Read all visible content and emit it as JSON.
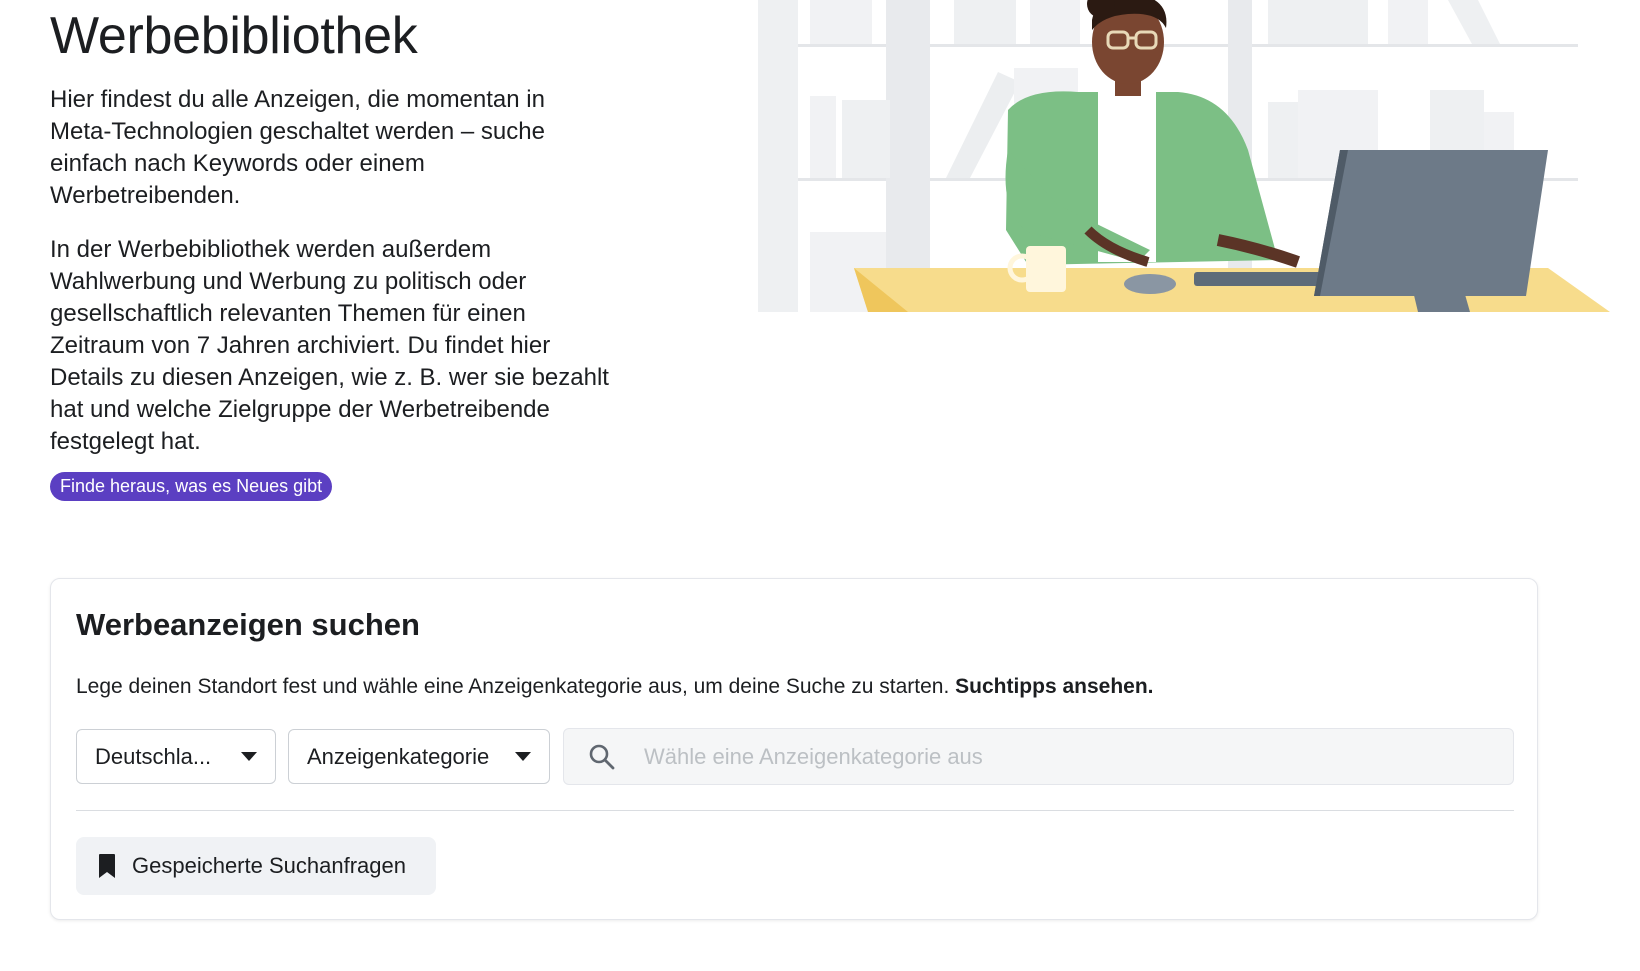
{
  "hero": {
    "title": "Werbebibliothek",
    "paragraph1": "Hier findest du alle Anzeigen, die momentan in Meta-Technologien geschaltet werden – suche einfach nach Keywords oder einem Werbetreibenden.",
    "paragraph2": "In der Werbebibliothek werden außerdem Wahlwerbung und Werbung zu politisch oder gesellschaftlich relevanten Themen für einen Zeitraum von 7 Jahren archiviert. Du findet hier Details zu diesen Anzeigen, wie z. B. wer sie bezahlt hat und welche Zielgruppe der Werbetreibende festgelegt hat.",
    "news_pill": "Finde heraus, was es Neues gibt",
    "illustration_icon": "person-at-computer-illustration"
  },
  "search_card": {
    "title": "Werbeanzeigen suchen",
    "description": "Lege deinen Standort fest und wähle eine Anzeigenkategorie aus, um deine Suche zu starten.",
    "tips_link": "Suchtipps ansehen.",
    "country_select": "Deutschla...",
    "category_select": "Anzeigenkategorie",
    "search_placeholder": "Wähle eine Anzeigenkategorie aus",
    "search_value": "",
    "saved_searches_label": "Gespeicherte Suchanfragen",
    "icons": {
      "search": "search-icon",
      "bookmark": "bookmark-icon",
      "caret": "caret-down-icon"
    }
  },
  "colors": {
    "accent_pill": "#5b3fc2",
    "text": "#1c1e21",
    "search_bg": "#f5f6f7",
    "button_bg": "#f0f2f5"
  }
}
